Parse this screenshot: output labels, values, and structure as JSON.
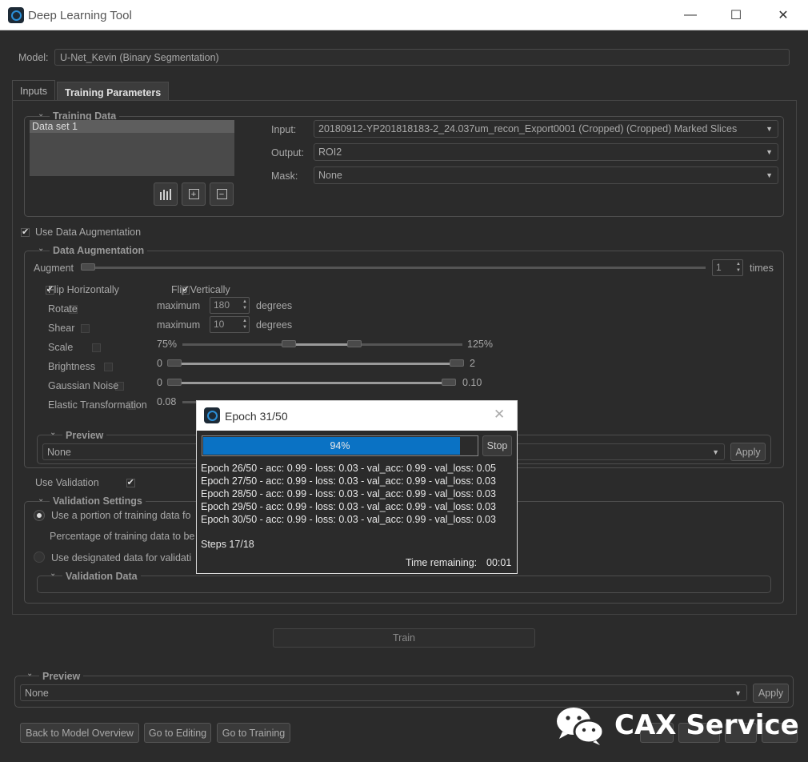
{
  "window": {
    "title": "Deep Learning Tool",
    "minimize": "—",
    "maximize": "☐",
    "close": "✕"
  },
  "model": {
    "label": "Model:",
    "value": "U-Net_Kevin (Binary Segmentation)"
  },
  "tabs": [
    {
      "label": "Inputs",
      "active": true
    },
    {
      "label": "Training Parameters",
      "active": false
    }
  ],
  "training_data": {
    "title": "Training Data",
    "datasets": [
      "Data set 1"
    ],
    "input_label": "Input:",
    "input_value": "20180912-YP201818183-2_24.037um_recon_Export0001 (Cropped) (Cropped) Marked Slices",
    "output_label": "Output:",
    "output_value": "ROI2",
    "mask_label": "Mask:",
    "mask_value": "None"
  },
  "use_data_augmentation": {
    "label": "Use Data Augmentation",
    "checked": true
  },
  "augmentation": {
    "title": "Data Augmentation",
    "augment_label": "Augment",
    "augment_value": "1",
    "times_label": "times",
    "flip_h": "Flip Horizontally",
    "flip_v": "Flip Vertically",
    "rotate": {
      "label": "Rotate",
      "max_label": "maximum",
      "value": "180",
      "unit": "degrees"
    },
    "shear": {
      "label": "Shear",
      "max_label": "maximum",
      "value": "10",
      "unit": "degrees"
    },
    "scale": {
      "label": "Scale",
      "min": "75%",
      "max": "125%"
    },
    "brightness": {
      "label": "Brightness",
      "min": "0",
      "max": "2"
    },
    "noise": {
      "label": "Gaussian Noise",
      "min": "0",
      "max": "0.10"
    },
    "elastic": {
      "label": "Elastic Transformation",
      "min": "0.08"
    },
    "preview_title": "Preview",
    "preview_value": "None",
    "apply": "Apply"
  },
  "use_validation": {
    "label": "Use Validation",
    "checked": true
  },
  "validation": {
    "title": "Validation Settings",
    "option1": "Use a portion of training data fo",
    "percentage": "Percentage of training data to be",
    "option2": "Use designated data for validati",
    "data_title": "Validation Data"
  },
  "train_button": "Train",
  "preview": {
    "title": "Preview",
    "value": "None",
    "apply": "Apply"
  },
  "bottom_buttons": [
    "Back to Model Overview",
    "Go to Editing",
    "Go to Training"
  ],
  "dialog": {
    "title": "Epoch 31/50",
    "progress_text": "94%",
    "progress_fraction": 0.94,
    "stop": "Stop",
    "log": [
      "Epoch 26/50 - acc: 0.99 - loss: 0.03 - val_acc: 0.99 - val_loss: 0.05",
      "Epoch 27/50 - acc: 0.99 - loss: 0.03 - val_acc: 0.99 - val_loss: 0.03",
      "Epoch 28/50 - acc: 0.99 - loss: 0.03 - val_acc: 0.99 - val_loss: 0.03",
      "Epoch 29/50 - acc: 0.99 - loss: 0.03 - val_acc: 0.99 - val_loss: 0.03",
      "Epoch 30/50 - acc: 0.99 - loss: 0.03 - val_acc: 0.99 - val_loss: 0.03"
    ],
    "steps": "Steps 17/18",
    "time_label": "Time remaining:",
    "time_value": "00:01"
  },
  "watermark": "CAX Service",
  "colors": {
    "accent": "#0a72c4",
    "background": "#2b2b2b"
  }
}
